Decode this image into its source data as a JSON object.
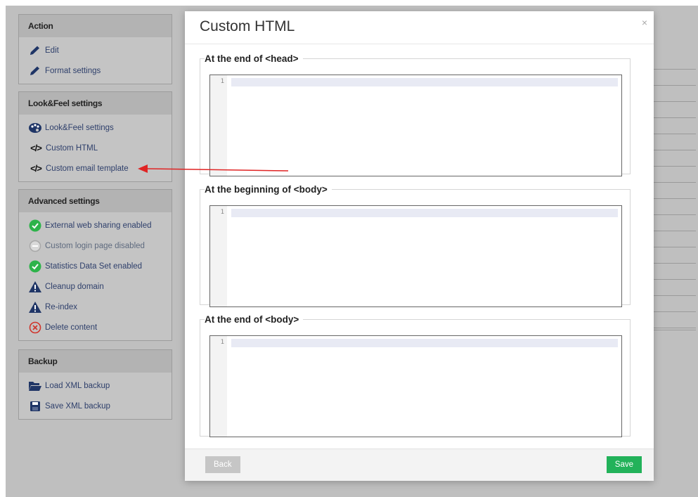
{
  "panels": {
    "action": {
      "title": "Action",
      "items": [
        {
          "label": "Edit",
          "icon": "pencil-icon"
        },
        {
          "label": "Format settings",
          "icon": "pencil-icon"
        }
      ]
    },
    "lookfeel": {
      "title": "Look&Feel settings",
      "items": [
        {
          "label": "Look&Feel settings",
          "icon": "palette-icon"
        },
        {
          "label": "Custom HTML",
          "icon": "code-icon"
        },
        {
          "label": "Custom email template",
          "icon": "code-icon"
        }
      ]
    },
    "advanced": {
      "title": "Advanced settings",
      "items": [
        {
          "label": "External web sharing enabled",
          "icon": "check-circle-icon"
        },
        {
          "label": "Custom login page disabled",
          "icon": "minus-circle-icon"
        },
        {
          "label": "Statistics Data Set enabled",
          "icon": "check-circle-icon"
        },
        {
          "label": "Cleanup domain",
          "icon": "warning-icon"
        },
        {
          "label": "Re-index",
          "icon": "warning-icon"
        },
        {
          "label": "Delete content",
          "icon": "x-circle-icon"
        }
      ]
    },
    "backup": {
      "title": "Backup",
      "items": [
        {
          "label": "Load XML backup",
          "icon": "folder-open-icon"
        },
        {
          "label": "Save XML backup",
          "icon": "floppy-icon"
        }
      ]
    }
  },
  "modal": {
    "title": "Custom HTML",
    "close_glyph": "×",
    "sections": [
      {
        "legend": "At the end of <head>",
        "line_number": "1"
      },
      {
        "legend": "At the beginning of <body>",
        "line_number": "1"
      },
      {
        "legend": "At the end of <body>",
        "line_number": "1"
      }
    ],
    "back_label": "Back",
    "save_label": "Save"
  },
  "colors": {
    "save": "#22b25a",
    "back": "#c6c6c6",
    "arrow": "#e02424",
    "check": "#2db34a",
    "warning": "#1f3566",
    "delete": "#d0342c",
    "link": "#2e3f6b"
  }
}
